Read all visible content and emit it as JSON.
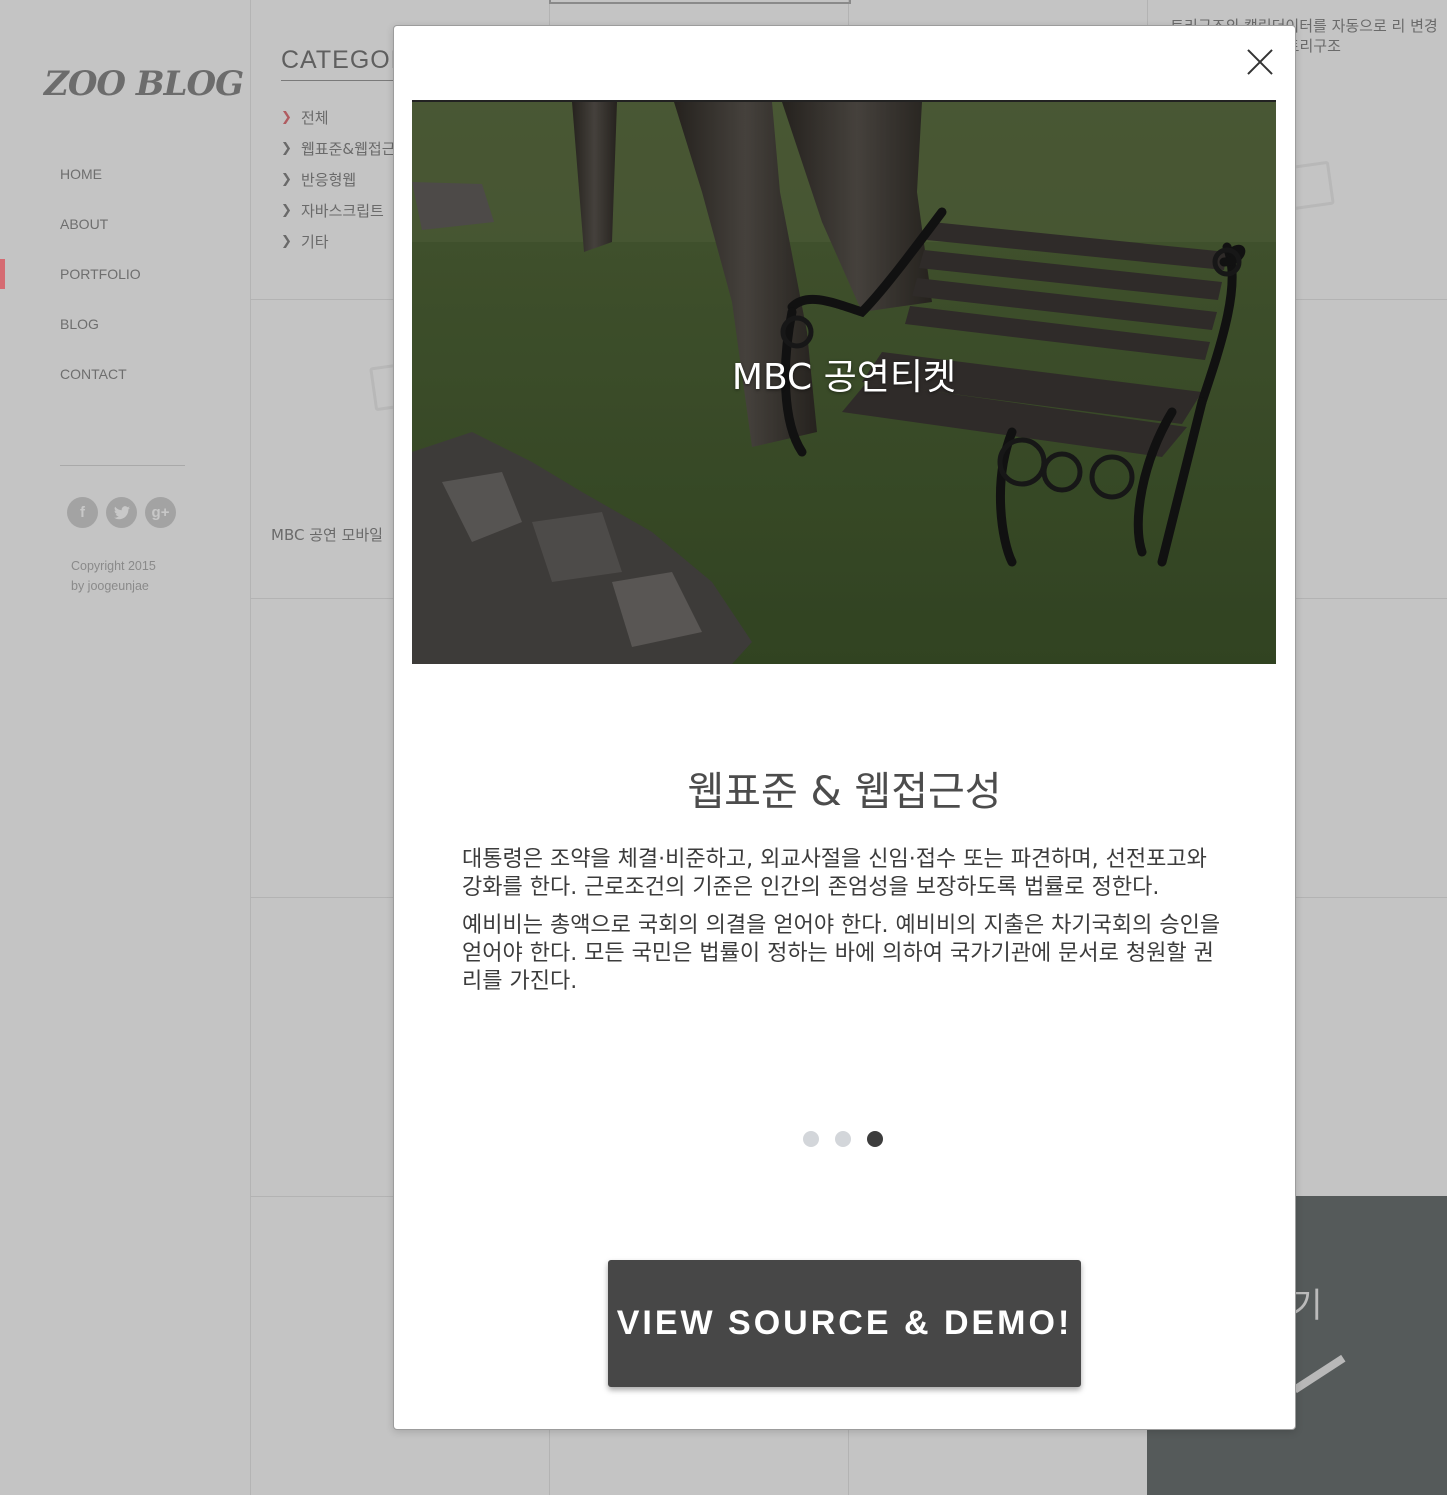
{
  "sidebar": {
    "logo": "ZOO BLOG",
    "nav": [
      "HOME",
      "ABOUT",
      "PORTFOLIO",
      "BLOG",
      "CONTACT"
    ],
    "active_nav": "PORTFOLIO",
    "social": [
      "f",
      "t",
      "g+"
    ],
    "social_icons": [
      "facebook-icon",
      "twitter-icon",
      "google-plus-icon"
    ],
    "copyright_line1": "Copyright 2015",
    "copyright_line2": "by joogeunjae"
  },
  "category": {
    "title": "CATEGOR",
    "items": [
      "전체",
      "웹표준&웹접근",
      "반응형웹",
      "자바스크립트",
      "기타"
    ],
    "active_item": "전체"
  },
  "tiles": {
    "tile_1_text": "MBC 공연 모바일",
    "tile_2_text": "트리구조의 캘린더이터를 자동으로 리 변경 및 트리구조",
    "dark_tile_label": "보기"
  },
  "modal": {
    "hero_caption": "MBC 공연티켓",
    "title": "웹표준 & 웹접근성",
    "paragraphs": [
      "대통령은 조약을 체결·비준하고, 외교사절을 신임·접수 또는 파견하며, 선전포고와 강화를 한다. 근로조건의 기준은 인간의 존엄성을 보장하도록 법률로 정한다.",
      "예비비는 총액으로 국회의 의결을 얻어야 한다. 예비비의 지출은 차기국회의 승인을 얻어야 한다. 모든 국민은 법률이 정하는 바에 의하여 국가기관에 문서로 청원할 권리를 가진다."
    ],
    "slides_total": 3,
    "active_slide": 3,
    "cta_label": "VIEW SOURCE & DEMO!",
    "close_icon": "close-icon"
  },
  "colors": {
    "accent": "#d56b72",
    "cta_bg": "#474747",
    "overlay_bg": "#c4c4c4",
    "dot_active": "#3d3d3d",
    "dot_inactive": "#d3d6da"
  }
}
